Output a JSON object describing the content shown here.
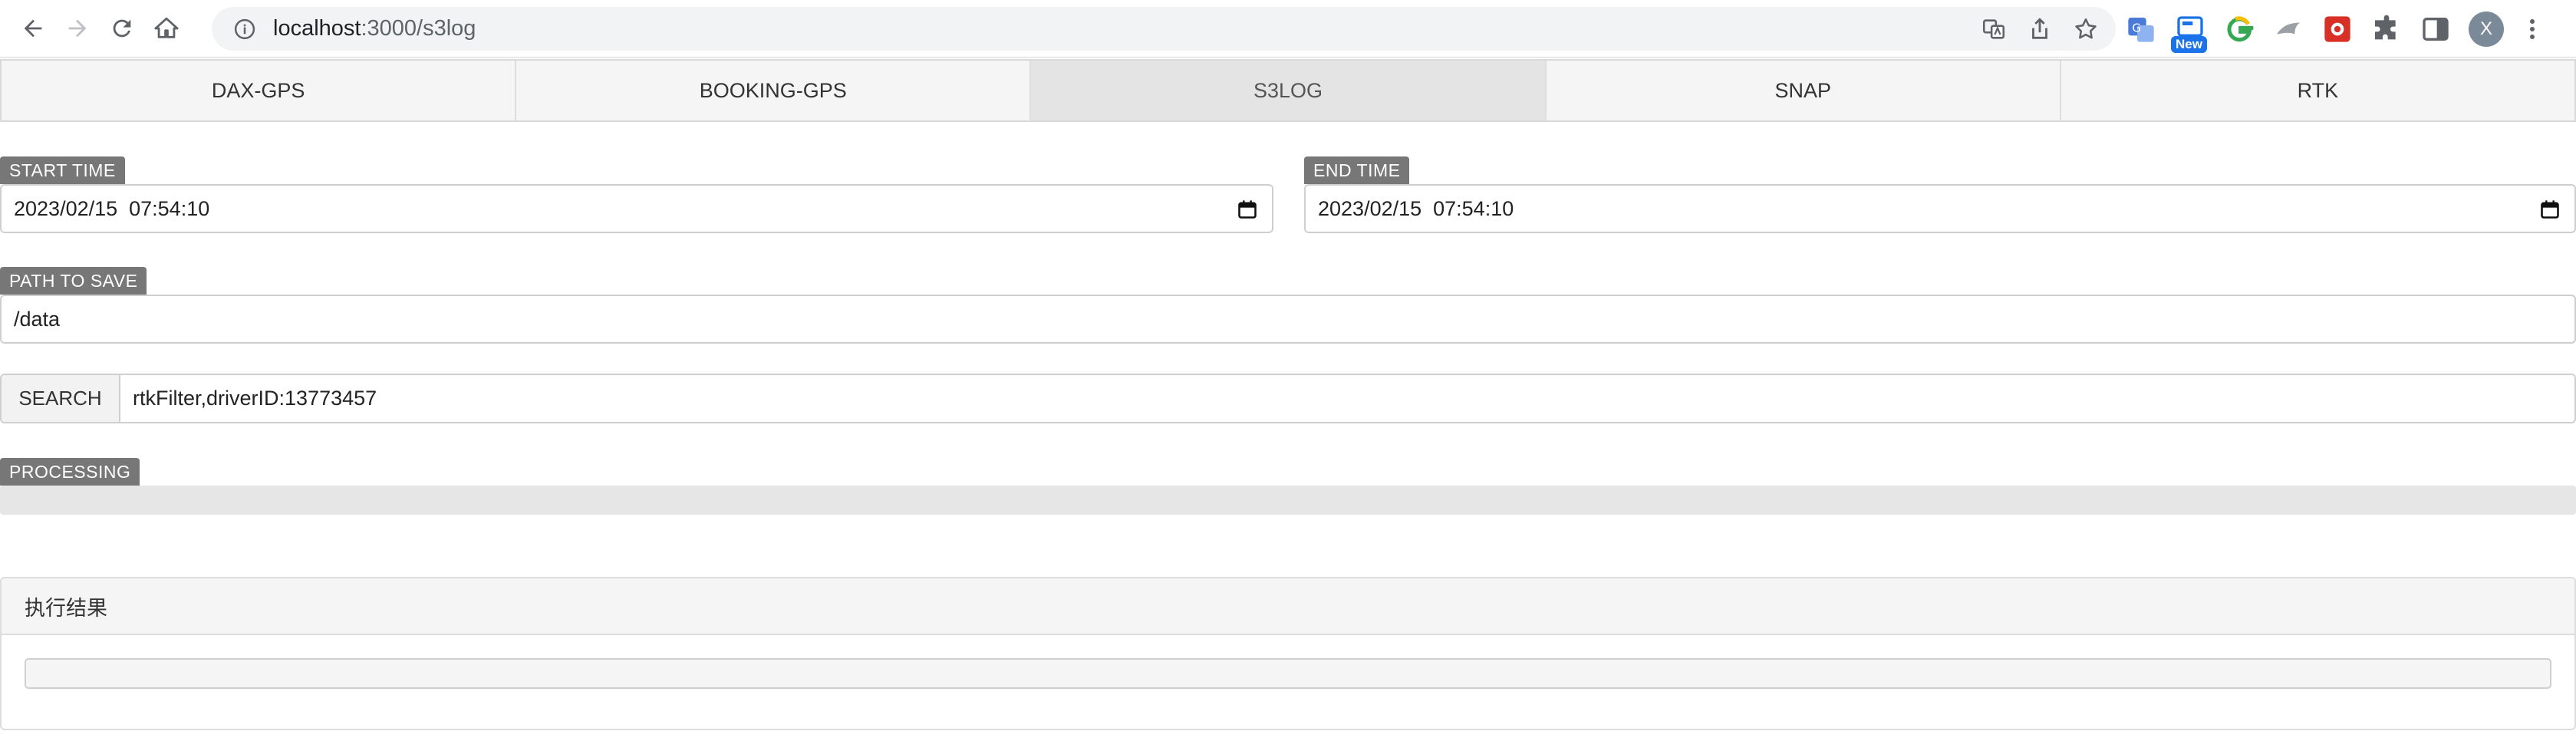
{
  "browser": {
    "url_host": "localhost",
    "url_path": ":3000/s3log",
    "extensions": [
      {
        "name": "translate-extension-icon",
        "color": "#4a7bd8"
      },
      {
        "name": "new-extension-icon",
        "color": "#1a73e8",
        "badge": "New"
      },
      {
        "name": "grammarly-extension-icon",
        "color": "#15c39a"
      },
      {
        "name": "dart-extension-icon",
        "color": "#9aa0a6"
      },
      {
        "name": "red-tool-extension-icon",
        "color": "#d93025"
      },
      {
        "name": "puzzle-extensions-icon",
        "color": "#5f6368"
      },
      {
        "name": "side-panel-icon",
        "color": "#5f6368"
      }
    ],
    "avatar_letter": "X"
  },
  "tabs": [
    {
      "label": "DAX-GPS",
      "active": false
    },
    {
      "label": "BOOKING-GPS",
      "active": false
    },
    {
      "label": "S3LOG",
      "active": true
    },
    {
      "label": "SNAP",
      "active": false
    },
    {
      "label": "RTK",
      "active": false
    }
  ],
  "form": {
    "start_time_label": "START TIME",
    "start_time_value": "2023/02/15  07:54:10",
    "end_time_label": "END TIME",
    "end_time_value": "2023/02/15  07:54:10",
    "path_label": "PATH TO SAVE",
    "path_value": "/data",
    "search_button": "SEARCH",
    "search_value": "rtkFilter,driverID:13773457",
    "processing_label": "PROCESSING",
    "progress_percent": 0
  },
  "result": {
    "title": "执行结果",
    "content": ""
  },
  "colors": {
    "badge_bg": "#777777",
    "tab_active_bg": "#e4e4e4",
    "progress_track": "#e6e6e6"
  }
}
